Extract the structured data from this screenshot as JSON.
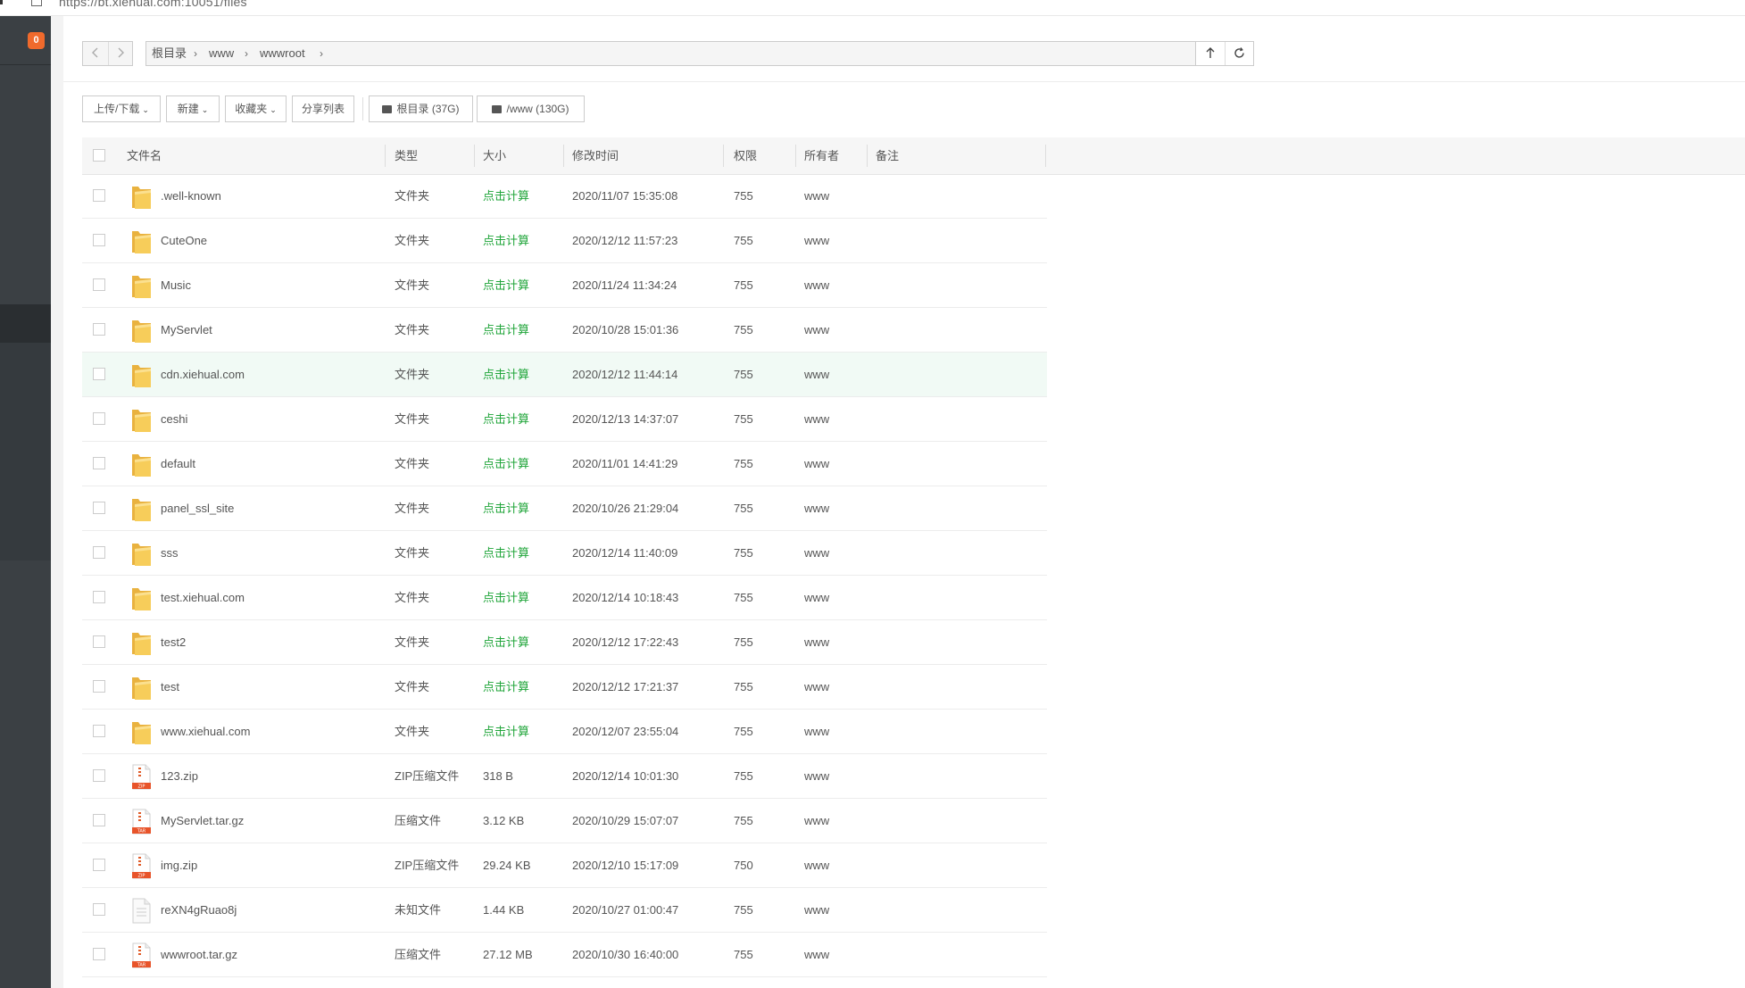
{
  "browser": {
    "url": "https://bt.xiehual.com:10051/files"
  },
  "sidebar": {
    "badge": "0"
  },
  "path": {
    "crumbs": [
      "根目录",
      "www",
      "wwwroot"
    ]
  },
  "toolbar": {
    "upload_label": "上传/下载",
    "new_label": "新建",
    "favorites_label": "收藏夹",
    "share_label": "分享列表",
    "disks": [
      "根目录 (37G)",
      "/www (130G)"
    ]
  },
  "table": {
    "columns": [
      "文件名",
      "类型",
      "大小",
      "修改时间",
      "权限",
      "所有者",
      "备注"
    ],
    "rows": [
      {
        "name": ".well-known",
        "type": "文件夹",
        "size": "点击计算",
        "mtime": "2020/11/07 15:35:08",
        "perm": "755",
        "owner": "www",
        "icon": "folder"
      },
      {
        "name": "CuteOne",
        "type": "文件夹",
        "size": "点击计算",
        "mtime": "2020/12/12 11:57:23",
        "perm": "755",
        "owner": "www",
        "icon": "folder"
      },
      {
        "name": "Music",
        "type": "文件夹",
        "size": "点击计算",
        "mtime": "2020/11/24 11:34:24",
        "perm": "755",
        "owner": "www",
        "icon": "folder"
      },
      {
        "name": "MyServlet",
        "type": "文件夹",
        "size": "点击计算",
        "mtime": "2020/10/28 15:01:36",
        "perm": "755",
        "owner": "www",
        "icon": "folder"
      },
      {
        "name": "cdn.xiehual.com",
        "type": "文件夹",
        "size": "点击计算",
        "mtime": "2020/12/12 11:44:14",
        "perm": "755",
        "owner": "www",
        "icon": "folder",
        "highlight": true
      },
      {
        "name": "ceshi",
        "type": "文件夹",
        "size": "点击计算",
        "mtime": "2020/12/13 14:37:07",
        "perm": "755",
        "owner": "www",
        "icon": "folder"
      },
      {
        "name": "default",
        "type": "文件夹",
        "size": "点击计算",
        "mtime": "2020/11/01 14:41:29",
        "perm": "755",
        "owner": "www",
        "icon": "folder"
      },
      {
        "name": "panel_ssl_site",
        "type": "文件夹",
        "size": "点击计算",
        "mtime": "2020/10/26 21:29:04",
        "perm": "755",
        "owner": "www",
        "icon": "folder"
      },
      {
        "name": "sss",
        "type": "文件夹",
        "size": "点击计算",
        "mtime": "2020/12/14 11:40:09",
        "perm": "755",
        "owner": "www",
        "icon": "folder"
      },
      {
        "name": "test.xiehual.com",
        "type": "文件夹",
        "size": "点击计算",
        "mtime": "2020/12/14 10:18:43",
        "perm": "755",
        "owner": "www",
        "icon": "folder"
      },
      {
        "name": "test2",
        "type": "文件夹",
        "size": "点击计算",
        "mtime": "2020/12/12 17:22:43",
        "perm": "755",
        "owner": "www",
        "icon": "folder"
      },
      {
        "name": "test",
        "type": "文件夹",
        "size": "点击计算",
        "mtime": "2020/12/12 17:21:37",
        "perm": "755",
        "owner": "www",
        "icon": "folder"
      },
      {
        "name": "www.xiehual.com",
        "type": "文件夹",
        "size": "点击计算",
        "mtime": "2020/12/07 23:55:04",
        "perm": "755",
        "owner": "www",
        "icon": "folder"
      },
      {
        "name": "123.zip",
        "type": "ZIP压缩文件",
        "size": "318 B",
        "mtime": "2020/12/14 10:01:30",
        "perm": "755",
        "owner": "www",
        "icon": "zip",
        "icon_label": "ZIP"
      },
      {
        "name": "MyServlet.tar.gz",
        "type": "压缩文件",
        "size": "3.12 KB",
        "mtime": "2020/10/29 15:07:07",
        "perm": "755",
        "owner": "www",
        "icon": "zip",
        "icon_label": "TAR"
      },
      {
        "name": "img.zip",
        "type": "ZIP压缩文件",
        "size": "29.24 KB",
        "mtime": "2020/12/10 15:17:09",
        "perm": "750",
        "owner": "www",
        "icon": "zip",
        "icon_label": "ZIP"
      },
      {
        "name": "reXN4gRuao8j",
        "type": "未知文件",
        "size": "1.44 KB",
        "mtime": "2020/10/27 01:00:47",
        "perm": "755",
        "owner": "www",
        "icon": "file"
      },
      {
        "name": "wwwroot.tar.gz",
        "type": "压缩文件",
        "size": "27.12 MB",
        "mtime": "2020/10/30 16:40:00",
        "perm": "755",
        "owner": "www",
        "icon": "zip",
        "icon_label": "TAR"
      }
    ]
  },
  "colors": {
    "accent_green": "#20a53a",
    "badge_orange": "#f06a2c",
    "sidebar_bg": "#3b4044",
    "folder_yellow": "#f5c24e"
  }
}
